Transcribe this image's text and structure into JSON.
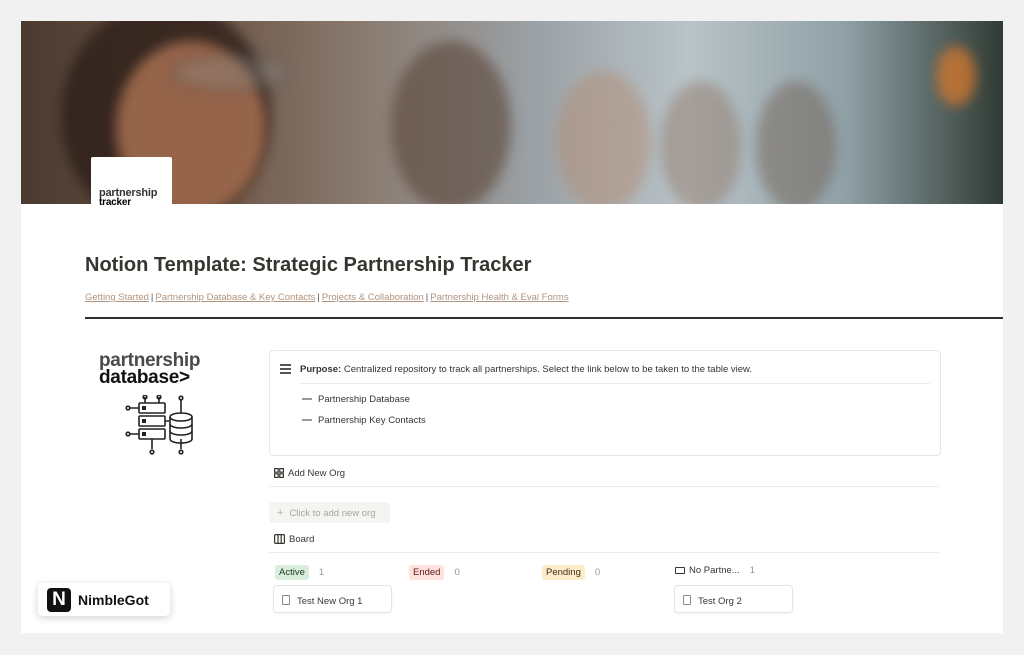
{
  "cover": {
    "badge_line1": "partnership",
    "badge_line2": "tracker"
  },
  "page": {
    "title": "Notion Template: Strategic Partnership Tracker"
  },
  "nav_links": [
    "Getting Started",
    "Partnership Database & Key Contacts",
    "Projects & Collaboration",
    "Partnership Health & Eval Forms"
  ],
  "nav_separator": "|",
  "logo": {
    "line1": "partnership",
    "line2": "database>"
  },
  "callout": {
    "purpose_label": "Purpose:",
    "purpose_text": " Centralized repository to track all partnerships. Select the link below to be taken to the table view.",
    "links": [
      "Partnership Database",
      "Partnership Key Contacts"
    ]
  },
  "add_view": {
    "title": "Add New Org",
    "button": "Click to add new org"
  },
  "board": {
    "title": "Board",
    "columns": [
      {
        "label": "Active",
        "count": "1",
        "bg": "#dbeddb",
        "fg": "#1c3829"
      },
      {
        "label": "Ended",
        "count": "0",
        "bg": "#ffe2dd",
        "fg": "#5d1715"
      },
      {
        "label": "Pending",
        "count": "0",
        "bg": "#fdecc8",
        "fg": "#402c1b"
      },
      {
        "label": "No Partne...",
        "count": "1",
        "bg": "#ffffff",
        "fg": "#37352f"
      }
    ],
    "cards": [
      "Test New Org 1",
      "Test Org 2"
    ]
  },
  "watermark": {
    "logo_letter": "N",
    "text": "NimbleGot"
  }
}
